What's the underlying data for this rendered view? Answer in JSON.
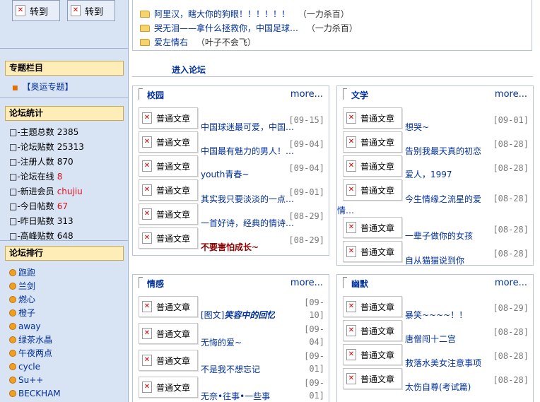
{
  "top_buttons": [
    {
      "label": "转到"
    },
    {
      "label": "转到"
    }
  ],
  "special": {
    "heading": "专题栏目",
    "item": "【奥运专题】"
  },
  "stats": {
    "heading": "论坛统计",
    "rows": [
      {
        "label": "主题总数",
        "value": "2385"
      },
      {
        "label": "论坛贴数",
        "value": "25313"
      },
      {
        "label": "注册人数",
        "value": "870"
      },
      {
        "label": "论坛在线",
        "value": "8"
      },
      {
        "label": "新进会员",
        "value": "chujiu"
      },
      {
        "label": "今日帖数",
        "value": "67"
      },
      {
        "label": "昨日贴数",
        "value": "313"
      },
      {
        "label": "高峰贴数",
        "value": "648"
      }
    ]
  },
  "ranking": {
    "heading": "论坛排行",
    "items": [
      "跑跑",
      "兰剑",
      "燃心",
      "橙子",
      "away",
      "绿茶水晶",
      "午夜两点",
      "cycle",
      "Su++",
      "BECKHAM"
    ]
  },
  "top_list": [
    {
      "title": "阿里汉，瞎大你的狗眼！！！！！！",
      "author": "（一力杀百）"
    },
    {
      "title": "哭无泪——拿什么拯救你，中国足球…",
      "author": "（一力杀百）"
    },
    {
      "title": "爱左情右",
      "author": "（叶子不会飞）"
    }
  ],
  "enter_forum": "进入论坛",
  "post_type": "普通文章",
  "more": "more...",
  "boards": [
    {
      "name": "校园",
      "posts": [
        {
          "title": "中国球迷最可爱，中国…",
          "date": "[09-15]"
        },
        {
          "title": "中国最有魅力的男人！…",
          "date": "[09-04]"
        },
        {
          "title": "youth青春~",
          "date": "[09-04]"
        },
        {
          "title": "其实我只要淡淡的一点…",
          "date": "[09-01]"
        },
        {
          "title": "一首好诗，经典的情诗…",
          "date": "[08-29]"
        },
        {
          "title": "不要害怕成长~",
          "date": "[08-29]"
        }
      ]
    },
    {
      "name": "文学",
      "posts": [
        {
          "title": "想哭~",
          "date": "[09-01]"
        },
        {
          "title": "告别我最天真的初恋",
          "date": "[08-28]"
        },
        {
          "title": "爱人，1997",
          "date": "[08-28]"
        },
        {
          "title": "今生情缘之流星的爱",
          "title2": "情…",
          "date": "[08-28]"
        },
        {
          "title": "一辈子做你的女孩",
          "date": "[08-28]"
        },
        {
          "title": "自从猫猫说到你",
          "date": "[08-28]"
        }
      ]
    },
    {
      "name": "情感",
      "posts": [
        {
          "prefix": "[图文]",
          "title": "笑容中的回忆",
          "date1": "[09-",
          "date2": "10]"
        },
        {
          "title": "无悔的爱~",
          "date1": "[09-",
          "date2": "04]"
        },
        {
          "title": "不是我不想忘记",
          "date1": "[09-",
          "date2": "01]"
        },
        {
          "title": "无奈•往事•一些事",
          "date1": "[09-",
          "date2": "01]"
        }
      ]
    },
    {
      "name": "幽默",
      "posts": [
        {
          "title": "暴笑~~~~！！",
          "date": "[08-29]"
        },
        {
          "title": "唐僧闯十二宫",
          "date": "[08-28]"
        },
        {
          "title": "救落水美女注意事项",
          "date": "[08-28]"
        },
        {
          "title": "太伤自尊(考试篇)",
          "date": "[08-28]"
        }
      ]
    }
  ]
}
